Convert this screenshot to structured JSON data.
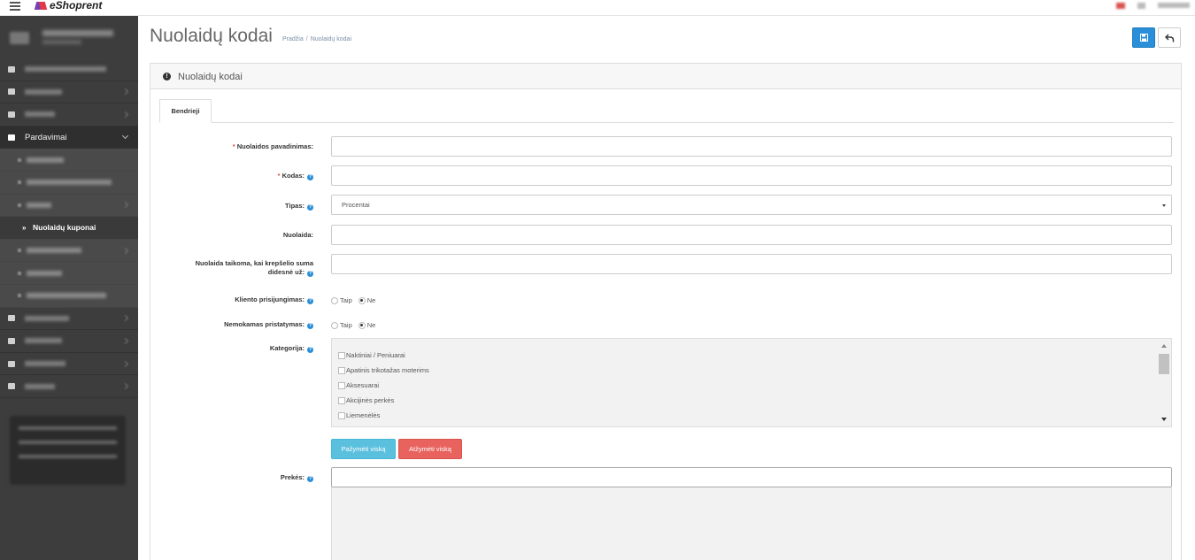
{
  "app": {
    "logo_text": "eShoprent"
  },
  "sidebar": {
    "active_section": "Pardavimai",
    "current_item": "Nuolaidų kuponai"
  },
  "header": {
    "title": "Nuolaidų kodai",
    "breadcrumb": [
      "Pradžia",
      "Nuolaidų kodai"
    ]
  },
  "panel": {
    "title": "Nuolaidų kodai",
    "tabs": [
      "Bendrieji"
    ]
  },
  "form": {
    "name_label": "Nuolaidos pavadinimas:",
    "code_label": "Kodas:",
    "type_label": "Tipas:",
    "type_value": "Procentai",
    "discount_label": "Nuolaida:",
    "threshold_label_line1": "Nuolaida taikoma, kai krepšelio suma",
    "threshold_label_line2": "didesnė už:",
    "login_label": "Kliento prisijungimas:",
    "shipping_label": "Nemokamas pristatymas:",
    "yes": "Taip",
    "no": "Ne",
    "category_label": "Kategorija:",
    "categories": [
      "Naktiniai / Peniuarai",
      "Apatinis trikotažas moterims",
      "Aksesuarai",
      "Akcijinės perkės",
      "Liemenėlės"
    ],
    "select_all": "Pažymėti viską",
    "deselect_all": "Atžymėti viską",
    "products_label": "Prekės:"
  },
  "colors": {
    "primary": "#2a8fd8",
    "info": "#5bc0de",
    "danger": "#e8625e",
    "sidebar": "#3d3d3d"
  }
}
